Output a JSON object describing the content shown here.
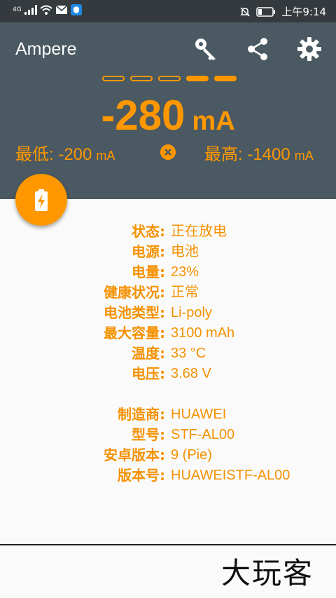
{
  "status_bar": {
    "network": "4G",
    "time": "上午9:14"
  },
  "app": {
    "title": "Ampere"
  },
  "toolbar": {
    "key_icon": "key-icon",
    "share_icon": "share-icon",
    "settings_icon": "gear-icon"
  },
  "current": {
    "value": "-280",
    "unit": "mA",
    "level_filled": 2,
    "level_total": 5
  },
  "minmax": {
    "min_label": "最低: -200",
    "min_unit": "mA",
    "max_label": "最高: -1400",
    "max_unit": "mA"
  },
  "info": {
    "battery": [
      {
        "k": "状态:",
        "v": "正在放电"
      },
      {
        "k": "电源:",
        "v": "电池"
      },
      {
        "k": "电量:",
        "v": "23%"
      },
      {
        "k": "健康状况:",
        "v": "正常"
      },
      {
        "k": "电池类型:",
        "v": "Li-poly"
      },
      {
        "k": "最大容量:",
        "v": "3100 mAh"
      },
      {
        "k": "温度:",
        "v": "33 °C"
      },
      {
        "k": "电压:",
        "v": "3.68 V"
      }
    ],
    "device": [
      {
        "k": "制造商:",
        "v": "HUAWEI"
      },
      {
        "k": "型号:",
        "v": "STF-AL00"
      },
      {
        "k": "安卓版本:",
        "v": "9 (Pie)"
      },
      {
        "k": "版本号:",
        "v": "HUAWEISTF-AL00"
      }
    ]
  },
  "watermark": "大玩客",
  "colors": {
    "accent": "#ff9800",
    "header": "#4a5962",
    "statusbar": "#353a3e"
  }
}
